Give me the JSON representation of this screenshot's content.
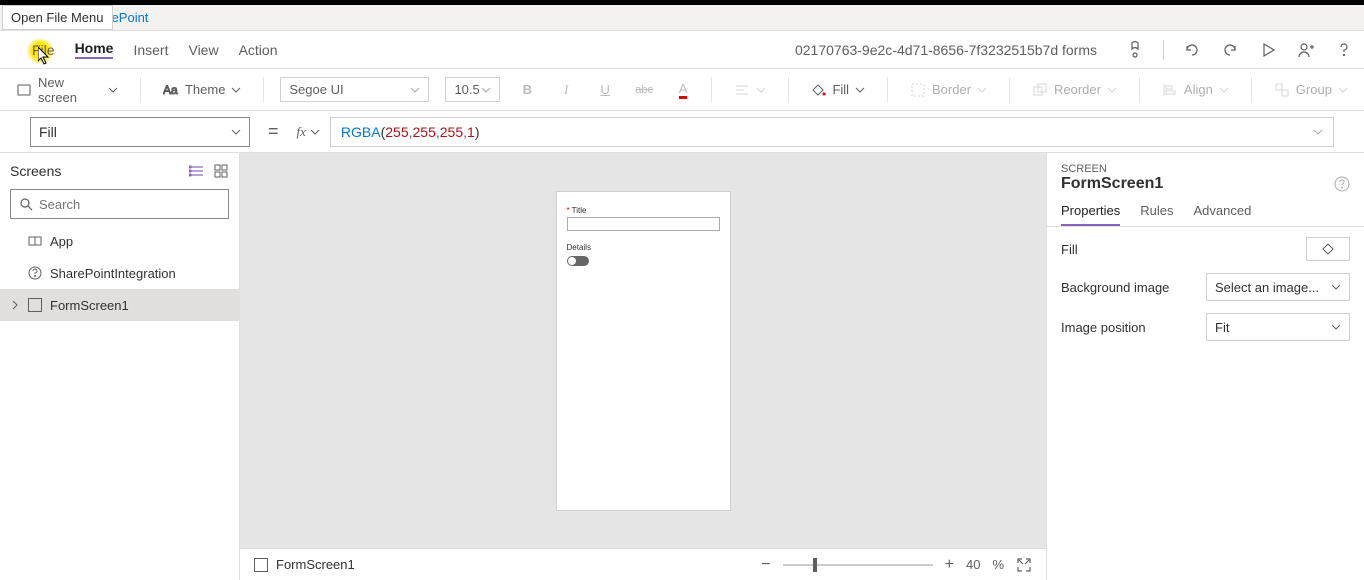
{
  "tooltip": "Open File Menu",
  "banner": "arePoint",
  "menu": {
    "file": "File",
    "home": "Home",
    "insert": "Insert",
    "view": "View",
    "action": "Action"
  },
  "app_id": "02170763-9e2c-4d71-8656-7f3232515b7d forms",
  "ribbon": {
    "new_screen": "New screen",
    "theme": "Theme",
    "font": "Segoe UI",
    "size": "10.5",
    "fill": "Fill",
    "border": "Border",
    "reorder": "Reorder",
    "align": "Align",
    "group": "Group"
  },
  "formula": {
    "prop_selected": "Fill",
    "expr_ident": "RGBA",
    "expr_args": [
      "255",
      "255",
      "255",
      "1"
    ]
  },
  "tree": {
    "title": "Screens",
    "search_placeholder": "Search",
    "items": [
      {
        "label": "App",
        "icon": "app"
      },
      {
        "label": "SharePointIntegration",
        "icon": "question"
      },
      {
        "label": "FormScreen1",
        "icon": "screen",
        "selected": true,
        "expandable": true
      }
    ]
  },
  "canvas_form": {
    "title_label": "Title",
    "details_label": "Details"
  },
  "status": {
    "screen_name": "FormScreen1",
    "zoom_value": "40",
    "zoom_unit": "%"
  },
  "props": {
    "type": "Screen",
    "name": "FormScreen1",
    "tabs": {
      "properties": "Properties",
      "rules": "Rules",
      "advanced": "Advanced"
    },
    "rows": {
      "fill_label": "Fill",
      "bg_label": "Background image",
      "bg_value": "Select an image...",
      "pos_label": "Image position",
      "pos_value": "Fit"
    }
  }
}
